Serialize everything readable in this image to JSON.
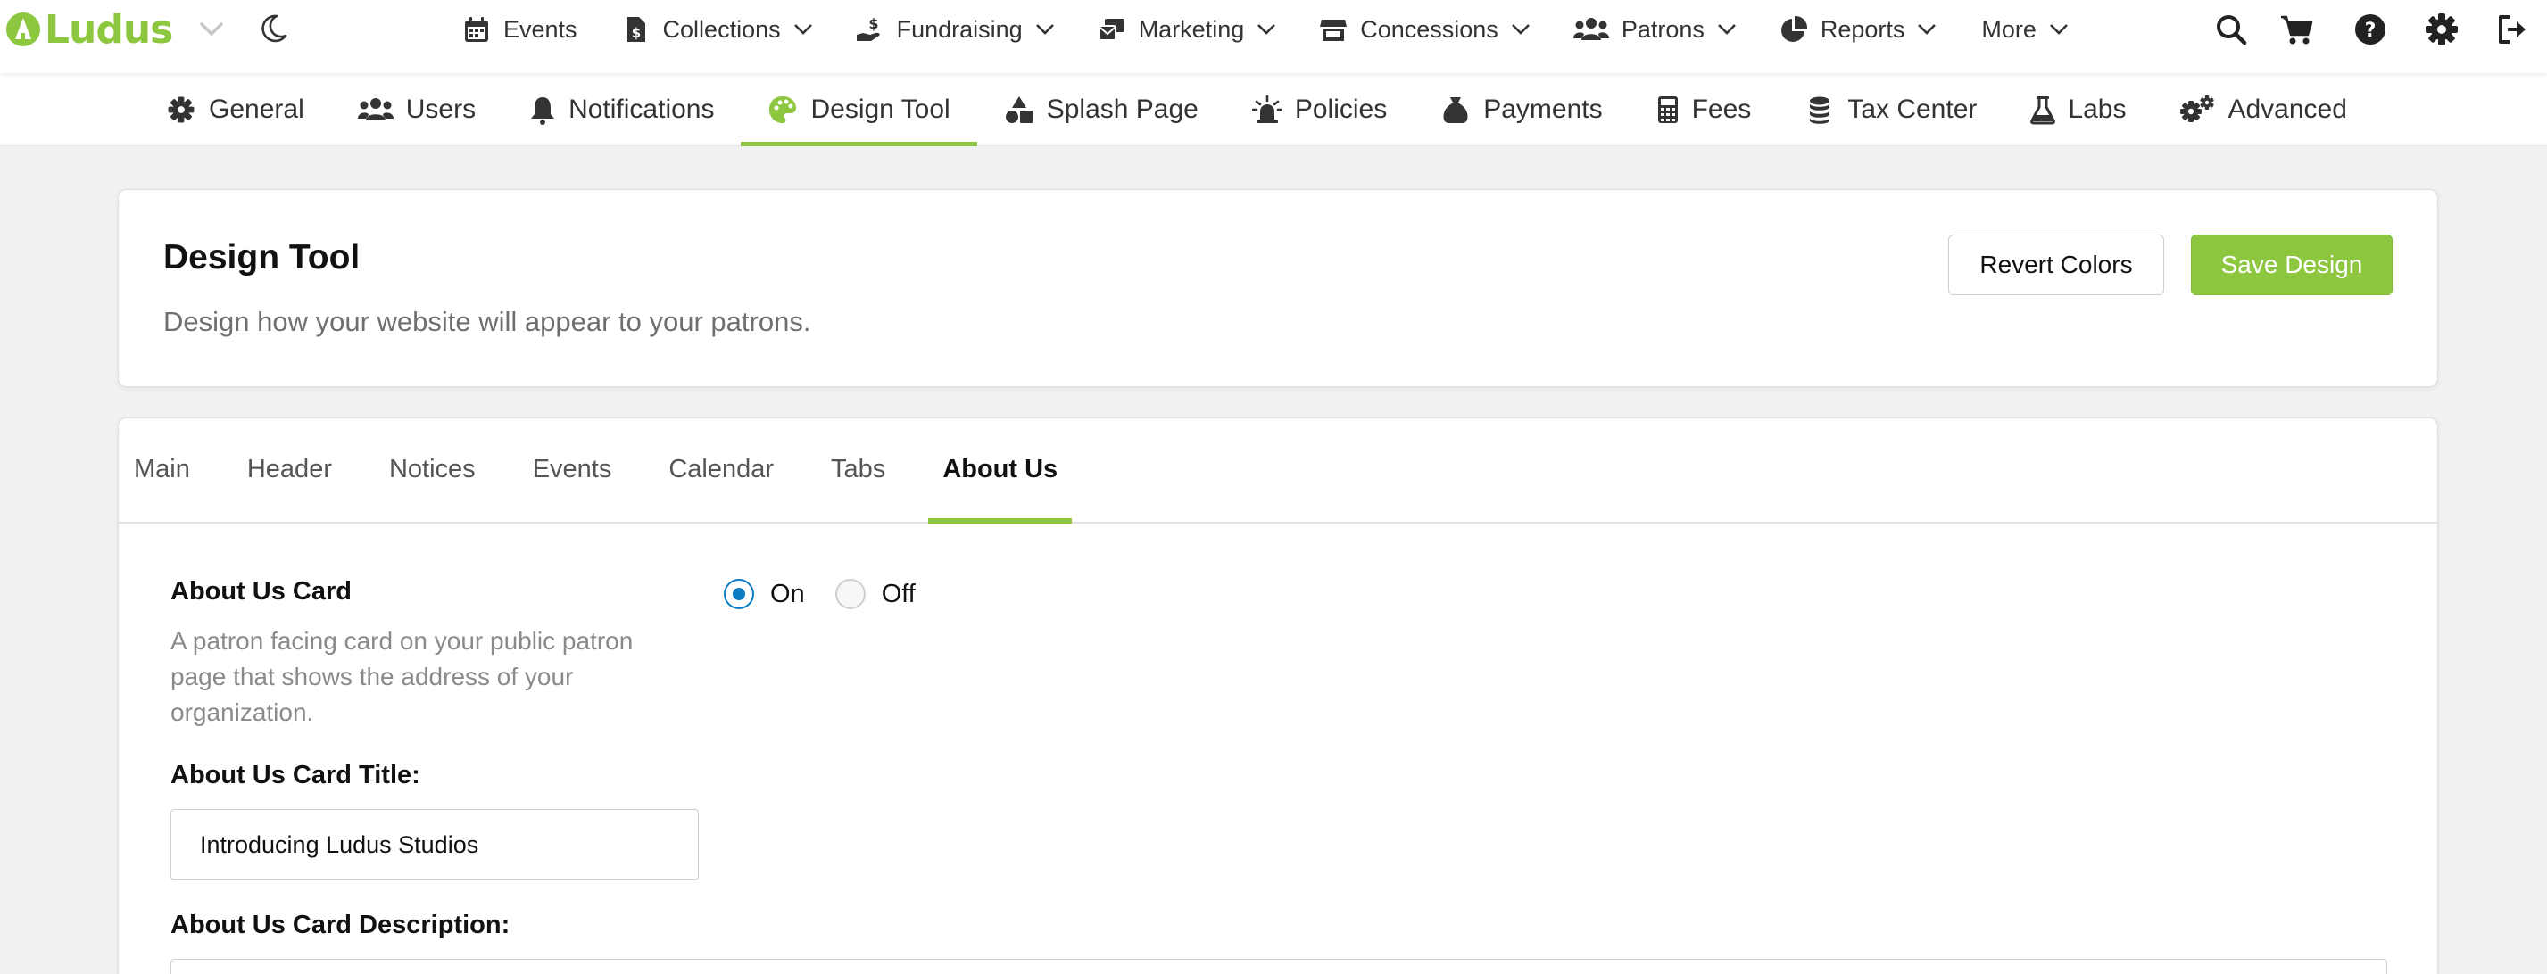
{
  "brand": {
    "name": "Ludus",
    "accent": "#8dc63f",
    "radio_blue": "#0b7dc4"
  },
  "topnav": {
    "items": [
      {
        "label": "Events",
        "icon": "calendar-icon",
        "dropdown": false
      },
      {
        "label": "Collections",
        "icon": "file-dollar-icon",
        "dropdown": true
      },
      {
        "label": "Fundraising",
        "icon": "hand-dollar-icon",
        "dropdown": true
      },
      {
        "label": "Marketing",
        "icon": "mail-bulk-icon",
        "dropdown": true
      },
      {
        "label": "Concessions",
        "icon": "store-icon",
        "dropdown": true
      },
      {
        "label": "Patrons",
        "icon": "users-icon",
        "dropdown": true
      },
      {
        "label": "Reports",
        "icon": "pie-chart-icon",
        "dropdown": true
      },
      {
        "label": "More",
        "icon": "",
        "dropdown": true
      }
    ],
    "right_icons": [
      "search-icon",
      "cart-icon",
      "help-icon",
      "settings-icon",
      "logout-icon"
    ]
  },
  "subnav": {
    "items": [
      {
        "label": "General",
        "icon": "gear-icon"
      },
      {
        "label": "Users",
        "icon": "users-icon"
      },
      {
        "label": "Notifications",
        "icon": "bell-icon"
      },
      {
        "label": "Design Tool",
        "icon": "palette-icon",
        "active": true
      },
      {
        "label": "Splash Page",
        "icon": "shapes-icon"
      },
      {
        "label": "Policies",
        "icon": "siren-icon"
      },
      {
        "label": "Payments",
        "icon": "money-bag-icon"
      },
      {
        "label": "Fees",
        "icon": "calculator-icon"
      },
      {
        "label": "Tax Center",
        "icon": "coins-icon"
      },
      {
        "label": "Labs",
        "icon": "flask-icon"
      },
      {
        "label": "Advanced",
        "icon": "gears-icon"
      }
    ]
  },
  "header": {
    "title": "Design Tool",
    "subtitle": "Design how your website will appear to your patrons.",
    "revert_label": "Revert Colors",
    "save_label": "Save Design"
  },
  "design_tabs": {
    "items": [
      "Main",
      "Header",
      "Notices",
      "Events",
      "Calendar",
      "Tabs",
      "About Us"
    ],
    "active": "About Us"
  },
  "about_us": {
    "card_label": "About Us Card",
    "card_description": "A patron facing card on your public patron page that shows the address of your organization.",
    "on_label": "On",
    "off_label": "Off",
    "card_enabled": "On",
    "title_label": "About Us Card Title:",
    "title_value": "Introducing Ludus Studios",
    "description_label": "About Us Card Description:"
  }
}
